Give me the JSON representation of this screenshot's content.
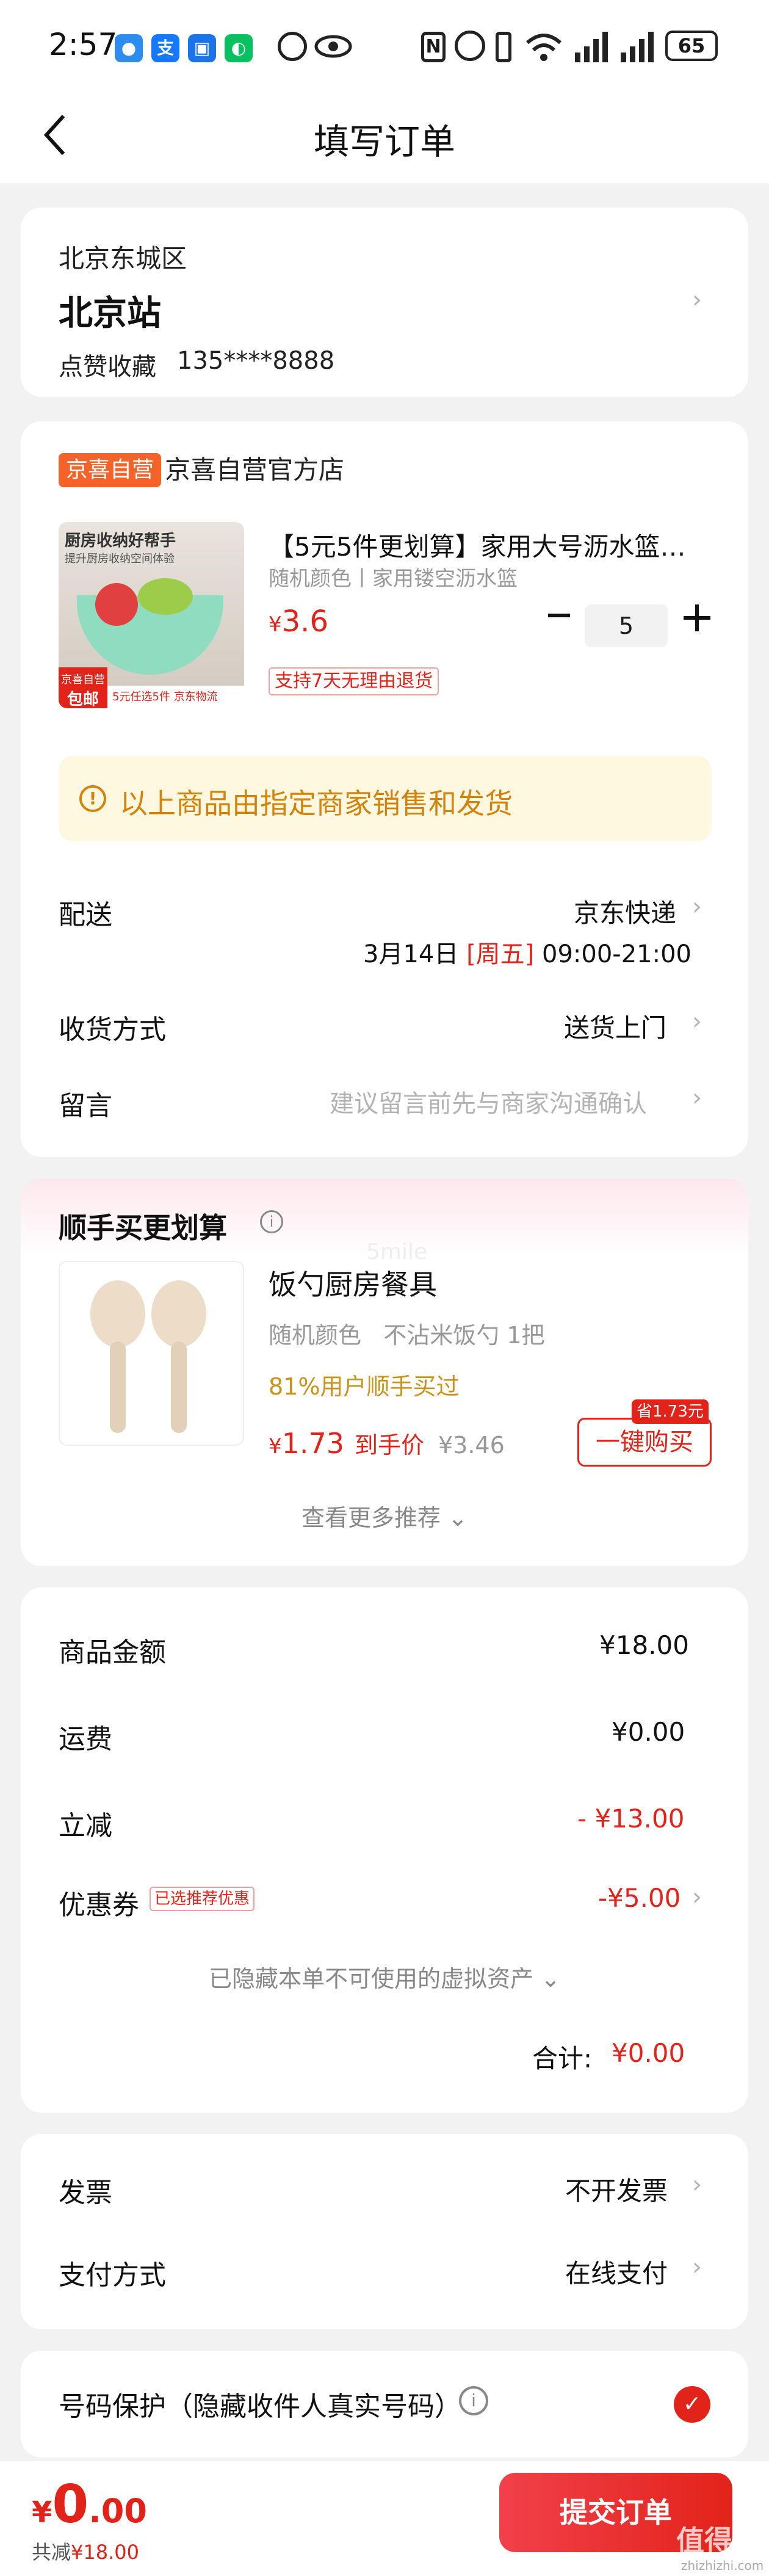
{
  "status_bar": {
    "time": "2:57",
    "battery": "65"
  },
  "header": {
    "title": "填写订单"
  },
  "address": {
    "region": "北京东城区",
    "detail": "北京站",
    "name": "点赞收藏",
    "phone": "135****8888"
  },
  "store": {
    "badge": "京喜自营",
    "name": "京喜自营官方店"
  },
  "product": {
    "title": "【5元5件更划算】家用大号沥水篮…",
    "spec": "随机颜色丨家用镂空沥水篮",
    "price_symbol": "¥",
    "price": "3.6",
    "quantity": "5",
    "return_tag": "支持7天无理由退货",
    "image_caption_top": "厨房收纳好帮手",
    "image_caption_sub": "提升厨房收纳空间体验",
    "image_badge_top": "京喜自营",
    "image_badge_bottom": "包邮",
    "image_promo": "5元任选5件 京东物流"
  },
  "notice": {
    "text": "以上商品由指定商家销售和发货"
  },
  "delivery": {
    "label": "配送",
    "carrier": "京东快递",
    "date": "3月14日",
    "weekday": "[周五]",
    "time_range": "09:00-21:00",
    "method_label": "收货方式",
    "method_value": "送货上门",
    "message_label": "留言",
    "message_placeholder": "建议留言前先与商家沟通确认"
  },
  "upsell": {
    "title": "顺手买更划算",
    "watermark": "5mile",
    "item_title": "饭勺厨房餐具",
    "item_spec": "随机颜色   不沾米饭勺 1把",
    "item_social": "81%用户顺手买过",
    "price_symbol": "¥",
    "price": "1.73",
    "price_suffix": "到手价",
    "original_price": "¥3.46",
    "save_tag": "省1.73元",
    "buy_button": "一键购买",
    "more": "查看更多推荐"
  },
  "summary": {
    "goods_label": "商品金额",
    "goods_value": "¥18.00",
    "shipping_label": "运费",
    "shipping_value": "¥0.00",
    "discount_label": "立减",
    "discount_value": "- ¥13.00",
    "coupon_label": "优惠券",
    "coupon_tag": "已选推荐优惠",
    "coupon_value": "-¥5.00",
    "hidden_assets": "已隐藏本单不可使用的虚拟资产",
    "total_label": "合计:",
    "total_value": "¥0.00"
  },
  "invoice": {
    "label": "发票",
    "value": "不开发票",
    "payment_label": "支付方式",
    "payment_value": "在线支付"
  },
  "privacy": {
    "label": "号码保护（隐藏收件人真实号码）",
    "checked": true
  },
  "bottom_bar": {
    "price_symbol": "¥",
    "price_int": "0",
    "price_dec": ".00",
    "total_label": "共减",
    "total_value": "¥18.00",
    "submit": "提交订单",
    "watermark_main": "值得值",
    "watermark_sub": "zhizhizhi.com"
  },
  "colors": {
    "accent": "#e2231a",
    "background": "#f2f2f2",
    "notice_bg": "#fff8e0",
    "store_badge": "#f5632a"
  }
}
